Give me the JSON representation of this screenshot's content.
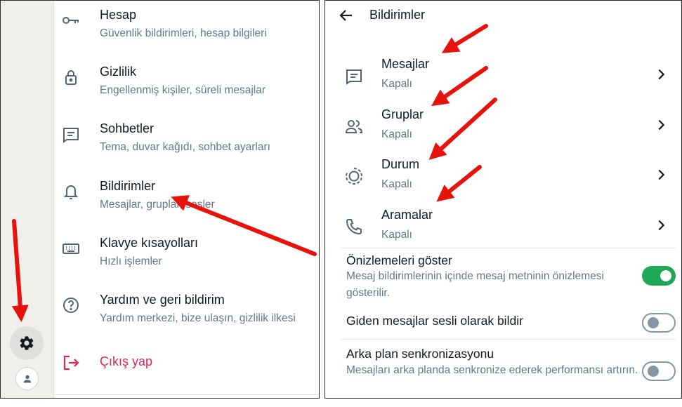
{
  "left": {
    "menu": [
      {
        "title": "Hesap",
        "subtitle": "Güvenlik bildirimleri, hesap bilgileri",
        "icon": "key-icon"
      },
      {
        "title": "Gizlilik",
        "subtitle": "Engellenmiş kişiler, süreli mesajlar",
        "icon": "lock-icon"
      },
      {
        "title": "Sohbetler",
        "subtitle": "Tema, duvar kağıdı, sohbet ayarları",
        "icon": "chat-icon"
      },
      {
        "title": "Bildirimler",
        "subtitle": "Mesajlar, gruplar, sesler",
        "icon": "bell-icon"
      },
      {
        "title": "Klavye kısayolları",
        "subtitle": "Hızlı işlemler",
        "icon": "keyboard-icon"
      },
      {
        "title": "Yardım ve geri bildirim",
        "subtitle": "Yardım merkezi, bize ulaşın, gizlilik ilkesi",
        "icon": "help-icon"
      },
      {
        "title": "Çıkış yap",
        "subtitle": "",
        "icon": "logout-icon"
      }
    ],
    "accent_logout": "#e0245e"
  },
  "right": {
    "title": "Bildirimler",
    "categories": [
      {
        "title": "Mesajlar",
        "status": "Kapalı",
        "icon": "message-icon"
      },
      {
        "title": "Gruplar",
        "status": "Kapalı",
        "icon": "group-icon"
      },
      {
        "title": "Durum",
        "status": "Kapalı",
        "icon": "status-icon"
      },
      {
        "title": "Aramalar",
        "status": "Kapalı",
        "icon": "phone-icon"
      }
    ],
    "toggles": [
      {
        "title": "Önizlemeleri göster",
        "description": "Mesaj bildirimlerinin içinde mesaj metninin önizlemesi gösterilir.",
        "on": true
      },
      {
        "title": "Giden mesajlar sesli olarak bildir",
        "description": "",
        "on": false
      },
      {
        "title": "Arka plan senkronizasyonu",
        "description": "Mesajları arka planda senkronize ederek performansı artırın.",
        "on": false
      }
    ],
    "toggle_on_color": "#1fa855"
  },
  "annotation_color": "#e8120c"
}
